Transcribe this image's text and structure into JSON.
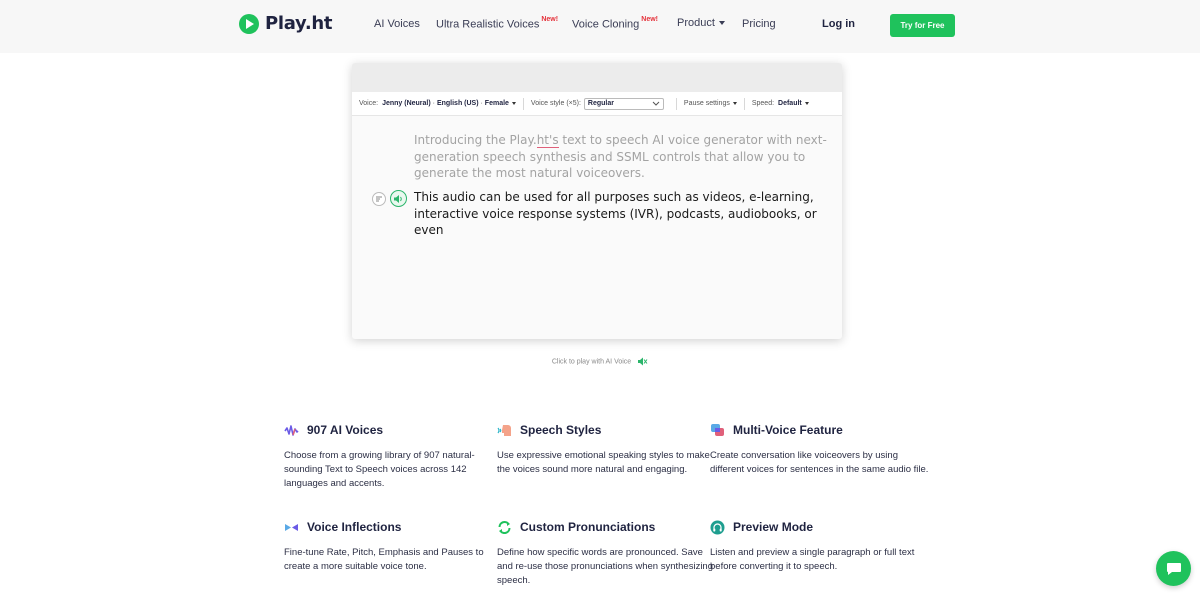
{
  "header": {
    "logo_text": "Play.ht",
    "nav": [
      {
        "label": "AI Voices",
        "badge": ""
      },
      {
        "label": "Ultra Realistic Voices",
        "badge": "New!"
      },
      {
        "label": "Voice Cloning",
        "badge": "New!"
      },
      {
        "label": "Product",
        "badge": ""
      },
      {
        "label": "Pricing",
        "badge": ""
      }
    ],
    "login_label": "Log in",
    "cta_label": "Try for Free"
  },
  "editor": {
    "voice_label": "Voice:",
    "voice_value": "Jenny (Neural)",
    "language_value": "English (US)",
    "gender_value": "Female",
    "style_label": "Voice style (×5):",
    "style_value": "Regular",
    "pause_label": "Pause settings",
    "speed_label": "Speed:",
    "speed_value": "Default",
    "paragraph1_pre": "Introducing the Play.",
    "paragraph1_highlight": "ht's",
    "paragraph1_post": " text to speech AI voice generator with next-generation speech synthesis and SSML controls that allow you to generate the most natural voiceovers.",
    "paragraph2": "This audio can be used for all purposes such as videos, e-learning, interactive voice response systems (IVR), podcasts, audiobooks, or even",
    "caption": "Click to play with AI Voice"
  },
  "features": [
    {
      "title": "907 AI Voices",
      "icon": "waveform-icon",
      "desc": "Choose from a growing library of 907 natural-sounding Text to Speech voices across 142 languages and accents."
    },
    {
      "title": "Speech Styles",
      "icon": "speaking-head-icon",
      "desc": "Use expressive emotional speaking styles to make the voices sound more natural and engaging."
    },
    {
      "title": "Multi-Voice Feature",
      "icon": "multi-voice-icon",
      "desc": "Create conversation like voiceovers by using different voices for sentences in the same audio file."
    },
    {
      "title": "Voice Inflections",
      "icon": "inflection-icon",
      "desc": "Fine-tune Rate, Pitch, Emphasis and Pauses to create a more suitable voice tone."
    },
    {
      "title": "Custom Pronunciations",
      "icon": "refresh-icon",
      "desc": "Define how specific words are pronounced. Save and re-use those pronunciations when synthesizing speech."
    },
    {
      "title": "Preview Mode",
      "icon": "headphones-icon",
      "desc": "Listen and preview a single paragraph or full text before converting it to speech."
    }
  ],
  "colors": {
    "brand_green": "#1fc25c",
    "badge_red": "#e5323b",
    "text_dark": "#1f2340"
  }
}
